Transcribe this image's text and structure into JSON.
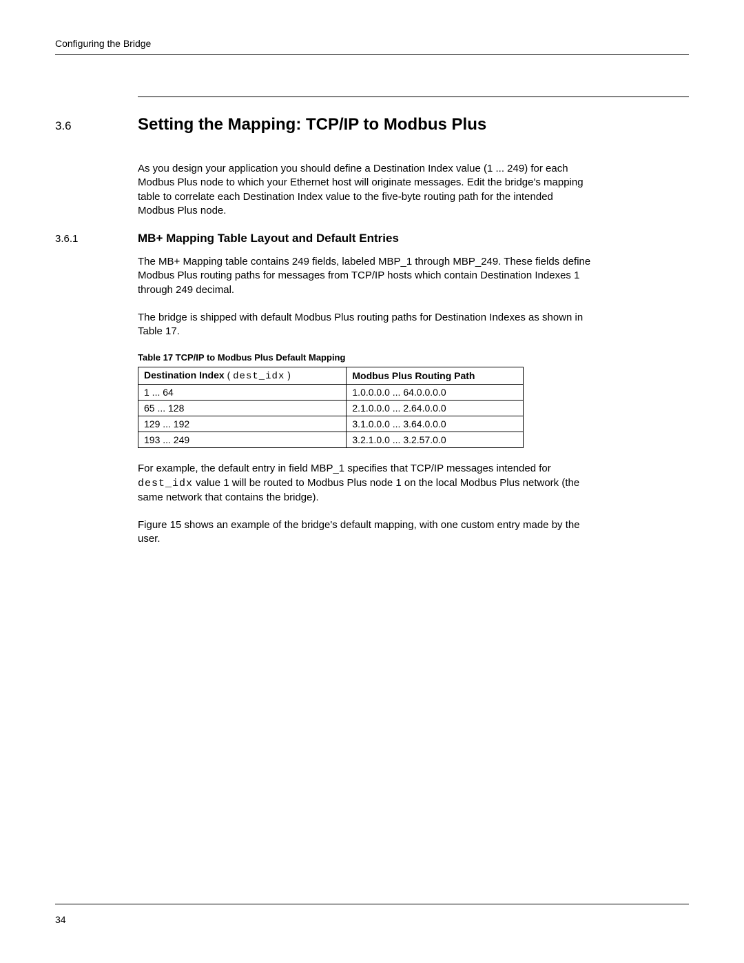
{
  "running_head": "Configuring the Bridge",
  "section": {
    "number": "3.6",
    "title": "Setting the Mapping:  TCP/IP to Modbus Plus",
    "intro_para": "As you design your application you should define a Destination Index value (1 ... 249) for each Modbus Plus node to which your Ethernet host will originate messages.  Edit the bridge's mapping table to correlate each Destination Index value to the five-byte routing path for the intended Modbus Plus node."
  },
  "subsection": {
    "number": "3.6.1",
    "title": "MB+ Mapping Table Layout and Default Entries",
    "para1": "The MB+ Mapping table contains 249 fields, labeled MBP_1 through MBP_249. These fields define Modbus Plus routing paths for messages from TCP/IP hosts which contain Destination Indexes 1 through 249 decimal.",
    "para2": "The bridge is shipped with default Modbus Plus routing paths for Destination Indexes as shown in Table  17."
  },
  "table": {
    "caption": "Table  17    TCP/IP to Modbus Plus Default Mapping",
    "header": {
      "col1_label": "Destination Index",
      "col1_param": "dest_idx",
      "col2": "Modbus Plus Routing Path"
    },
    "rows": [
      {
        "dest": "1   ...   64",
        "path": "1.0.0.0.0   ...   64.0.0.0.0"
      },
      {
        "dest": "65   ...   128",
        "path": "2.1.0.0.0   ...   2.64.0.0.0"
      },
      {
        "dest": "129   ...   192",
        "path": "3.1.0.0.0   ...   3.64.0.0.0"
      },
      {
        "dest": "193   ...   249",
        "path": "3.2.1.0.0   ...   3.2.57.0.0"
      }
    ]
  },
  "after_table": {
    "para1_pre": "For example, the default entry in field MBP_1 specifies that TCP/IP messages intended for ",
    "para1_code": "dest_idx",
    "para1_post": " value 1 will be routed to Modbus Plus node 1 on the local Modbus Plus network (the same network that contains the bridge).",
    "para2": "Figure 15 shows an example of the bridge's default mapping, with one custom entry made by the user."
  },
  "page_number": "34"
}
